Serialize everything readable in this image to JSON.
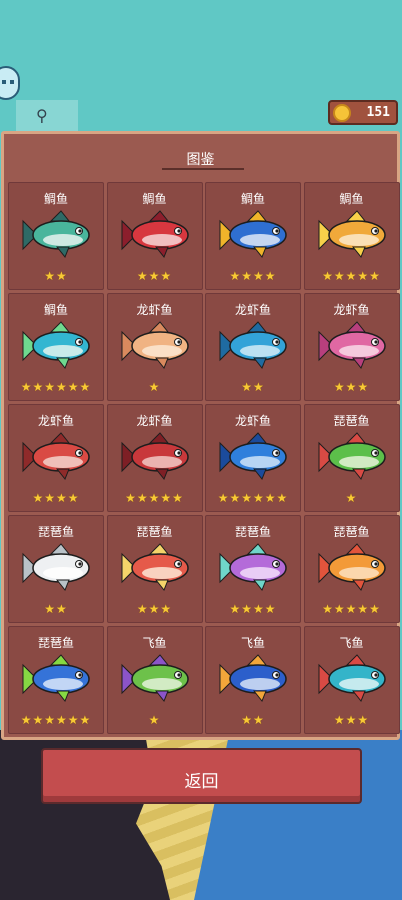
{
  "coins": "151",
  "panel": {
    "title": "图鉴"
  },
  "fish_cards": [
    {
      "name": "鲷鱼",
      "stars": "★★",
      "rating": 2,
      "body": "#49b59c",
      "fin": "#2e6a66",
      "belly": "#e5f2ef"
    },
    {
      "name": "鲷鱼",
      "stars": "★★★",
      "rating": 3,
      "body": "#d7373f",
      "fin": "#8c1e2c",
      "belly": "#f6d6d7"
    },
    {
      "name": "鲷鱼",
      "stars": "★★★★",
      "rating": 4,
      "body": "#2f6fd1",
      "fin": "#f0b42a",
      "belly": "#dfe9f7"
    },
    {
      "name": "鲷鱼",
      "stars": "★★★★★",
      "rating": 5,
      "body": "#f0a93a",
      "fin": "#f7d04a",
      "belly": "#fbeacb"
    },
    {
      "name": "鲷鱼",
      "stars": "★★★★★★",
      "rating": 6,
      "body": "#33b6d1",
      "fin": "#6fd98f",
      "belly": "#e3f5ee"
    },
    {
      "name": "龙虾鱼",
      "stars": "★",
      "rating": 1,
      "body": "#f0b383",
      "fin": "#d98a5e",
      "belly": "#fbe7d3"
    },
    {
      "name": "龙虾鱼",
      "stars": "★★",
      "rating": 2,
      "body": "#33a3d8",
      "fin": "#1f6ba1",
      "belly": "#d3ecf7"
    },
    {
      "name": "龙虾鱼",
      "stars": "★★★",
      "rating": 3,
      "body": "#e068a3",
      "fin": "#b83f7d",
      "belly": "#f8dbe8"
    },
    {
      "name": "龙虾鱼",
      "stars": "★★★★",
      "rating": 4,
      "body": "#d94a44",
      "fin": "#8f2a2a",
      "belly": "#f3d3cd"
    },
    {
      "name": "龙虾鱼",
      "stars": "★★★★★",
      "rating": 5,
      "body": "#c8383b",
      "fin": "#7e1f25",
      "belly": "#f1c9c6"
    },
    {
      "name": "龙虾鱼",
      "stars": "★★★★★★",
      "rating": 6,
      "body": "#2f7fdc",
      "fin": "#1b4b9c",
      "belly": "#cfe4f8"
    },
    {
      "name": "琵琶鱼",
      "stars": "★",
      "rating": 1,
      "body": "#5cbf4a",
      "fin": "#d94a44",
      "belly": "#e5f2d8"
    },
    {
      "name": "琵琶鱼",
      "stars": "★★",
      "rating": 2,
      "body": "#eef0f2",
      "fin": "#b9c2c8",
      "belly": "#ffffff"
    },
    {
      "name": "琵琶鱼",
      "stars": "★★★",
      "rating": 3,
      "body": "#e55a4a",
      "fin": "#f4d46a",
      "belly": "#fde7d5"
    },
    {
      "name": "琵琶鱼",
      "stars": "★★★★",
      "rating": 4,
      "body": "#b46bd9",
      "fin": "#6fd6c9",
      "belly": "#f2def9"
    },
    {
      "name": "琵琶鱼",
      "stars": "★★★★★",
      "rating": 5,
      "body": "#f39a38",
      "fin": "#e2543c",
      "belly": "#fbe2c2"
    },
    {
      "name": "琵琶鱼",
      "stars": "★★★★★★",
      "rating": 6,
      "body": "#3573d8",
      "fin": "#86d843",
      "belly": "#dbe8fa"
    },
    {
      "name": "飞鱼",
      "stars": "★",
      "rating": 1,
      "body": "#6dc14a",
      "fin": "#8b54c8",
      "belly": "#e4f2d9"
    },
    {
      "name": "飞鱼",
      "stars": "★★",
      "rating": 2,
      "body": "#2c5fcb",
      "fin": "#f2a63a",
      "belly": "#d7e3f7"
    },
    {
      "name": "飞鱼",
      "stars": "★★★",
      "rating": 3,
      "body": "#34b4c9",
      "fin": "#d94a44",
      "belly": "#dff3f5"
    }
  ],
  "back_button": {
    "label": "返回"
  }
}
